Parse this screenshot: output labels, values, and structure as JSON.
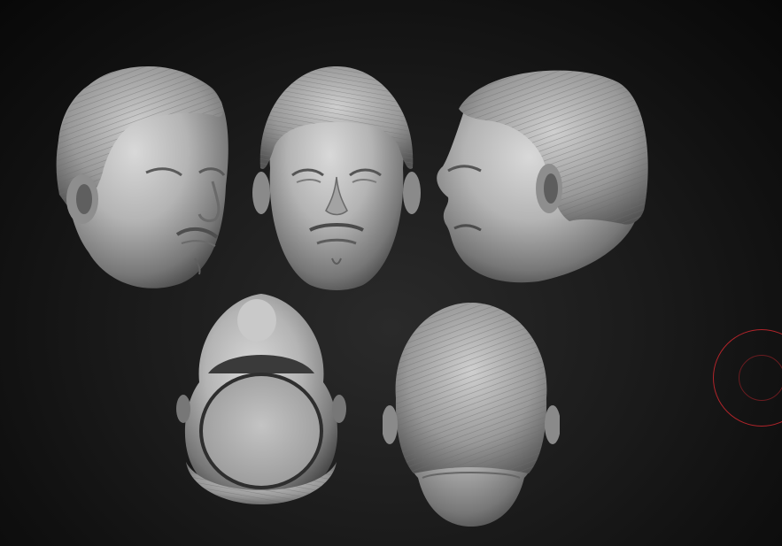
{
  "scene": {
    "background_color": "#161616",
    "material_color": "#b9b9b9",
    "views": [
      {
        "name": "three-quarter-left",
        "icon": "head-sculpt-three-quarter"
      },
      {
        "name": "front",
        "icon": "head-sculpt-front"
      },
      {
        "name": "profile-left",
        "icon": "head-sculpt-profile"
      },
      {
        "name": "bottom",
        "icon": "head-sculpt-bottom"
      },
      {
        "name": "back",
        "icon": "head-sculpt-back"
      }
    ]
  },
  "brush_cursor": {
    "icon": "brush-circle-cursor",
    "color": "#b0242a"
  }
}
